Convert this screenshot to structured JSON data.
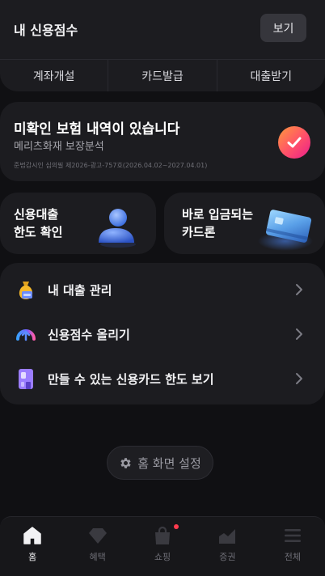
{
  "score": {
    "title": "내 신용점수",
    "view_label": "보기"
  },
  "quick_actions": [
    {
      "label": "계좌개설"
    },
    {
      "label": "카드발급"
    },
    {
      "label": "대출받기"
    }
  ],
  "insurance": {
    "title": "미확인 보험 내역이 있습니다",
    "subtitle": "메리츠화재 보장분석",
    "fine_print": "준법감시인 심의필 제2026-광고-757호(2026.04.02~2027.04.01)",
    "icon": "check-badge-icon"
  },
  "promo_cards": [
    {
      "line1": "신용대출",
      "line2": "한도 확인",
      "icon": "person-3d-icon"
    },
    {
      "line1": "바로 입금되는",
      "line2": "카드론",
      "icon": "card-3d-icon"
    }
  ],
  "menu": [
    {
      "label": "내 대출 관리",
      "icon": "money-bag-icon"
    },
    {
      "label": "신용점수 올리기",
      "icon": "score-gauge-icon"
    },
    {
      "label": "만들 수 있는 신용카드 한도 보기",
      "icon": "credit-card-icon"
    }
  ],
  "home_settings": {
    "label": "홈 화면 설정",
    "icon": "gear-icon"
  },
  "nav": [
    {
      "label": "홈",
      "icon": "home-icon",
      "active": true
    },
    {
      "label": "혜택",
      "icon": "gem-icon",
      "active": false
    },
    {
      "label": "쇼핑",
      "icon": "shopping-bag-icon",
      "active": false,
      "badge": true
    },
    {
      "label": "증권",
      "icon": "stock-chart-icon",
      "active": false
    },
    {
      "label": "전체",
      "icon": "menu-icon",
      "active": false
    }
  ],
  "colors": {
    "background": "#101013",
    "card": "#1c1c20",
    "badge_dot": "#ff3b4e",
    "check_gradient": [
      "#ff9a3c",
      "#e91e8c"
    ]
  }
}
